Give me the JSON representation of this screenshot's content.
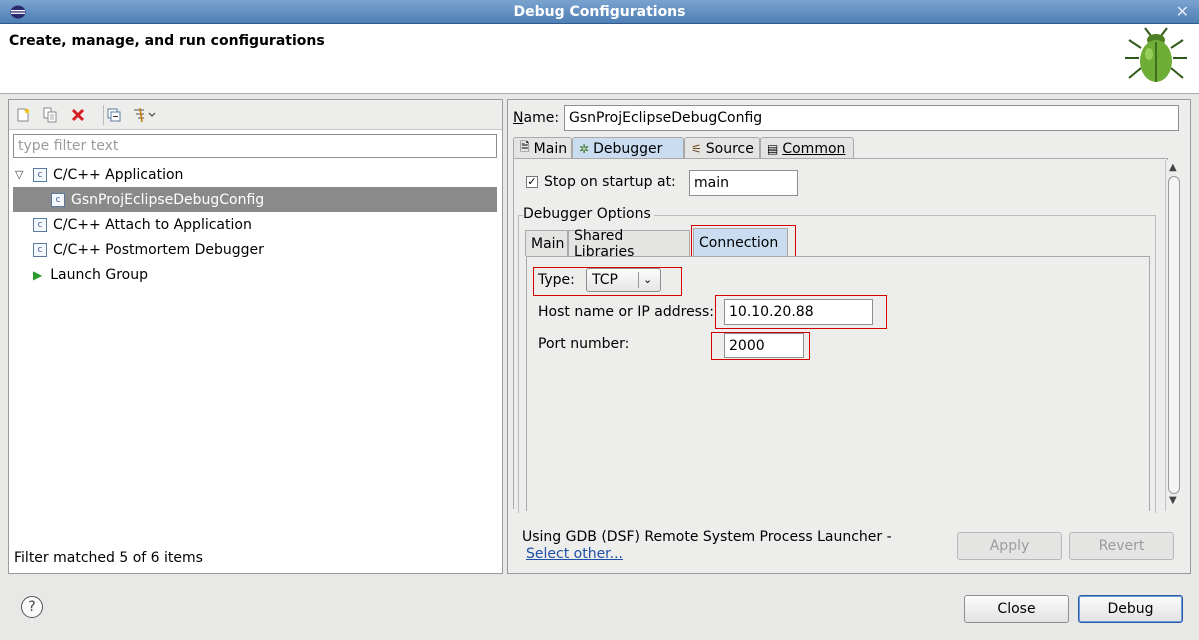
{
  "window": {
    "title": "Debug Configurations"
  },
  "banner": {
    "heading": "Create, manage, and run configurations"
  },
  "left": {
    "filter_placeholder": "type filter text",
    "tree": [
      {
        "label": "C/C++ Application",
        "expanded": true
      },
      {
        "label": "GsnProjEclipseDebugConfig",
        "selected": true
      },
      {
        "label": "C/C++ Attach to Application"
      },
      {
        "label": "C/C++ Postmortem Debugger"
      },
      {
        "label": "Launch Group"
      }
    ],
    "status": "Filter matched 5 of 6 items"
  },
  "right": {
    "name_label": "Name:",
    "name_value": "GsnProjEclipseDebugConfig",
    "tabs": [
      "Main",
      "Debugger",
      "Source",
      "Common"
    ],
    "active_tab": "Debugger",
    "stop_on_startup_label": "Stop on startup at:",
    "stop_on_startup_value": "main",
    "debugger_options_label": "Debugger Options",
    "inner_tabs": [
      "Main",
      "Shared Libraries",
      "Connection"
    ],
    "active_inner_tab": "Connection",
    "type_label": "Type:",
    "type_value": "TCP",
    "host_label": "Host name or IP address:",
    "host_value": "10.10.20.88",
    "port_label": "Port number:",
    "port_value": "2000",
    "launcher_text": "Using GDB (DSF) Remote System Process Launcher -",
    "select_other": "Select other...",
    "apply_label": "Apply",
    "revert_label": "Revert"
  },
  "footer": {
    "close_label": "Close",
    "debug_label": "Debug"
  },
  "colors": {
    "highlight": "#d40000",
    "selection": "#8a8a8a",
    "active_tab": "#c9dcf0"
  }
}
